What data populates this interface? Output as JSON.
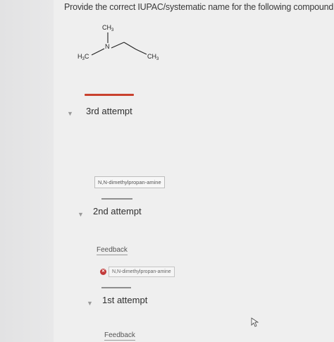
{
  "question": {
    "text": "Provide the correct IUPAC/systematic name for the following compound."
  },
  "structure": {
    "top_label_main": "CH",
    "top_label_sub": "3",
    "nitrogen_label": "N",
    "left_label_h": "H",
    "left_label_sub": "3",
    "left_label_c": "C",
    "right_label_main": "CH",
    "right_label_sub": "3"
  },
  "attempts": [
    {
      "title": "3rd attempt",
      "answer": "N,N-dimethylpropan-amine"
    },
    {
      "title": "2nd attempt",
      "feedback_label": "Feedback",
      "answer": "N,N-dimethylpropan-amine"
    },
    {
      "title": "1st attempt",
      "feedback_label": "Feedback"
    }
  ],
  "colors": {
    "accent_red": "#c9412e",
    "wrong_red": "#c23a3a"
  }
}
